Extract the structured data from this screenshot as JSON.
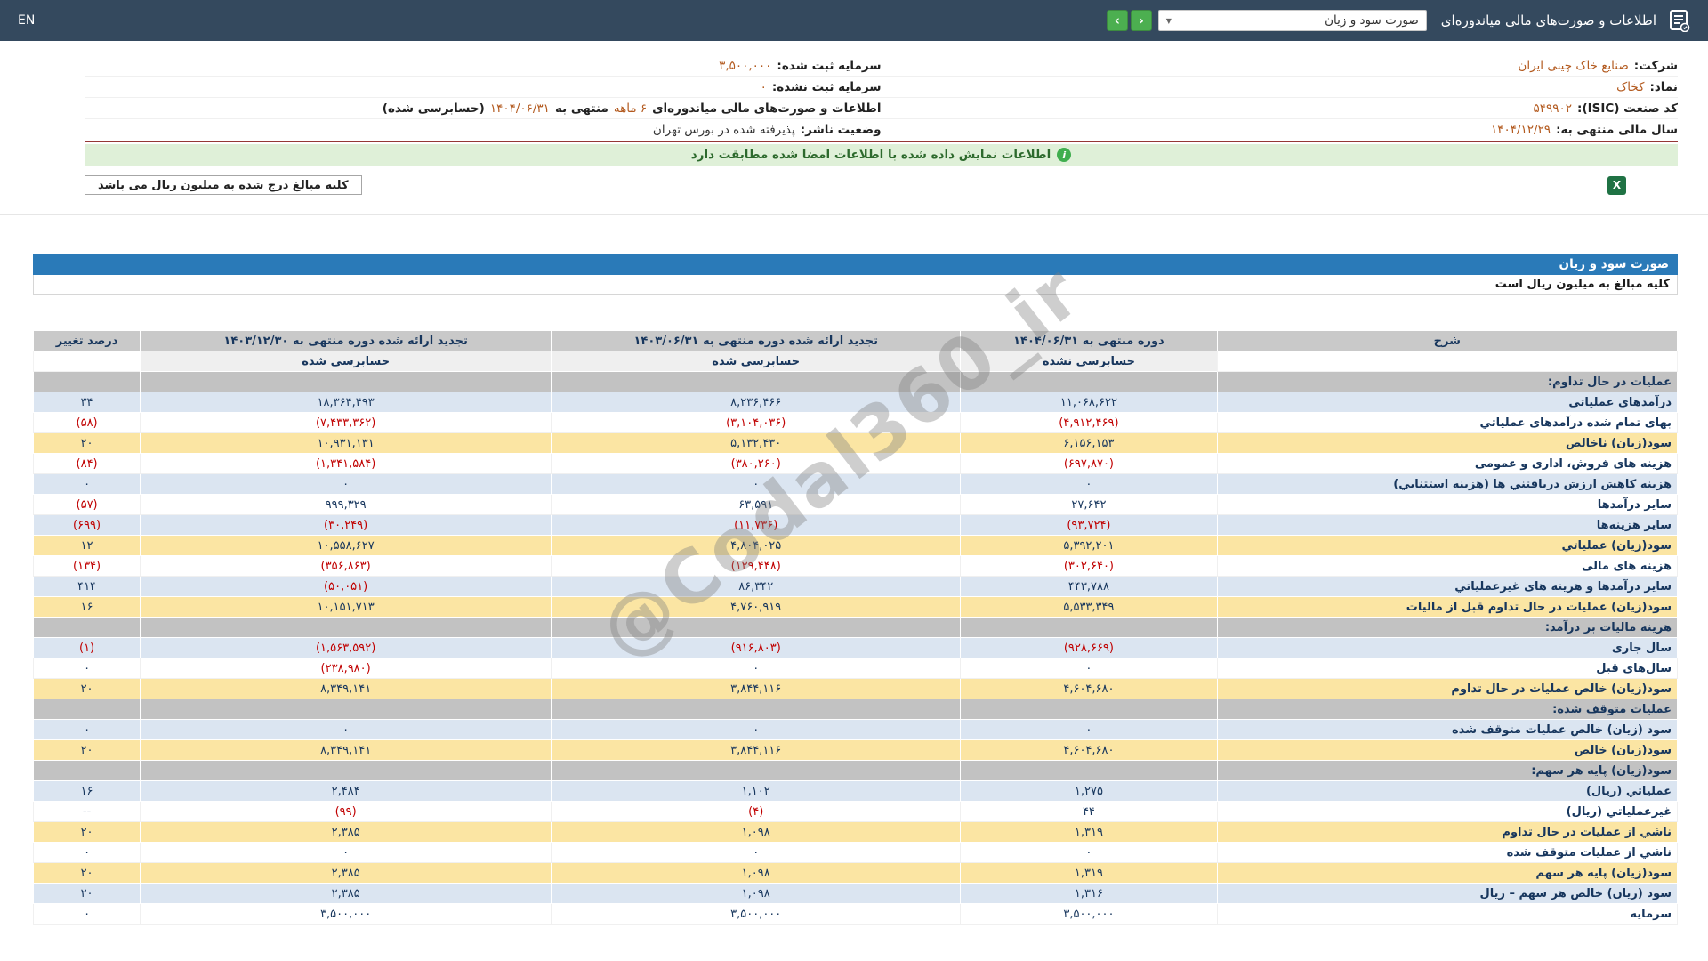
{
  "topbar": {
    "title": "اطلاعات و صورت‌های مالی میاندوره‌ای",
    "dropdown_value": "صورت سود و زیان",
    "prev_label": "‹",
    "next_label": "›",
    "en_label": "EN"
  },
  "company_info": {
    "right_column": [
      [
        {
          "t": "شرکت:",
          "s": "label"
        },
        {
          "t": "صنایع خاک چینی ایران",
          "s": "value"
        }
      ],
      [
        {
          "t": "نماد:",
          "s": "label"
        },
        {
          "t": "کخاک",
          "s": "value"
        }
      ],
      [
        {
          "t": "کد صنعت (ISIC):",
          "s": "label"
        },
        {
          "t": "۵۴۹۹۰۲",
          "s": "value"
        }
      ],
      [
        {
          "t": "سال مالی منتهی به:",
          "s": "label"
        },
        {
          "t": "۱۴۰۴/۱۲/۲۹",
          "s": "value"
        }
      ]
    ],
    "left_column": [
      [
        {
          "t": "سرمایه ثبت شده:",
          "s": "label"
        },
        {
          "t": "۳,۵۰۰,۰۰۰",
          "s": "value"
        }
      ],
      [
        {
          "t": "سرمایه ثبت نشده:",
          "s": "label"
        },
        {
          "t": "۰",
          "s": "value"
        }
      ],
      [
        {
          "t": "اطلاعات و صورت‌های مالی میاندوره‌ای",
          "s": "label"
        },
        {
          "t": "۶ ماهه",
          "s": "value"
        },
        {
          "t": "منتهی به",
          "s": "label"
        },
        {
          "t": "۱۴۰۴/۰۶/۳۱",
          "s": "value"
        },
        {
          "t": "(حسابرسی شده)",
          "s": "label"
        }
      ],
      [
        {
          "t": "وضعیت ناشر:",
          "s": "label"
        },
        {
          "t": "پذیرفته شده در بورس تهران",
          "s": "dark"
        }
      ]
    ]
  },
  "banner": {
    "text": "اطلاعات نمایش داده شده با اطلاعات امضا شده مطابقت دارد"
  },
  "unit_note": "کلیه مبالغ درج شده به میلیون ریال می باشد",
  "watermark": "@Codal360_ir",
  "statement": {
    "title_bar": "صورت سود و زیان",
    "unit_note": "کلیه مبالغ به میلیون ریال است",
    "table": {
      "desc_header": "شرح",
      "change_header": "درصد تغییر",
      "period_columns": [
        {
          "title": "دوره منتهی به ۱۴۰۴/۰۶/۳۱",
          "sub": "حسابرسی نشده"
        },
        {
          "title": "تجدید ارائه شده دوره منتهی به ۱۴۰۳/۰۶/۳۱",
          "sub": "حسابرسی شده"
        },
        {
          "title": "تجدید ارائه شده دوره منتهی به ۱۴۰۳/۱۲/۳۰",
          "sub": "حسابرسی شده"
        }
      ],
      "rows": [
        {
          "kind": "section",
          "label": "عملیات در حال تداوم:"
        },
        {
          "kind": "blue",
          "label": "درآمدهای عملیاتي",
          "values": [
            "۱۱,۰۶۸,۶۲۲",
            "۸,۲۳۶,۴۶۶",
            "۱۸,۳۶۴,۴۹۳"
          ],
          "change": "۳۴"
        },
        {
          "kind": "white",
          "label": "بهای تمام شده درآمدهای عملیاتي",
          "values": [
            "(۴,۹۱۲,۴۶۹)",
            "(۳,۱۰۴,۰۳۶)",
            "(۷,۴۳۳,۳۶۲)"
          ],
          "change": "(۵۸)"
        },
        {
          "kind": "yellow",
          "label": "سود(زیان) ناخالص",
          "values": [
            "۶,۱۵۶,۱۵۳",
            "۵,۱۳۲,۴۳۰",
            "۱۰,۹۳۱,۱۳۱"
          ],
          "change": "۲۰"
        },
        {
          "kind": "white",
          "label": "هزینه های فروش، اداری و عمومی",
          "values": [
            "(۶۹۷,۸۷۰)",
            "(۳۸۰,۲۶۰)",
            "(۱,۳۴۱,۵۸۴)"
          ],
          "change": "(۸۴)"
        },
        {
          "kind": "blue",
          "label": "هزینه کاهش ارزش دریافتني ها (هزینه استثنایي)",
          "values": [
            "۰",
            "۰",
            "۰"
          ],
          "change": "۰"
        },
        {
          "kind": "white",
          "label": "سایر درآمدها",
          "values": [
            "۲۷,۶۴۲",
            "۶۳,۵۹۱",
            "۹۹۹,۳۲۹"
          ],
          "change": "(۵۷)"
        },
        {
          "kind": "blue",
          "label": "سایر هزینه‌ها",
          "values": [
            "(۹۳,۷۲۴)",
            "(۱۱,۷۳۶)",
            "(۳۰,۲۴۹)"
          ],
          "change": "(۶۹۹)"
        },
        {
          "kind": "yellow",
          "label": "سود(زیان) عملیاتي",
          "values": [
            "۵,۳۹۲,۲۰۱",
            "۴,۸۰۴,۰۲۵",
            "۱۰,۵۵۸,۶۲۷"
          ],
          "change": "۱۲"
        },
        {
          "kind": "white",
          "label": "هزینه های مالی",
          "values": [
            "(۳۰۲,۶۴۰)",
            "(۱۲۹,۴۴۸)",
            "(۳۵۶,۸۶۳)"
          ],
          "change": "(۱۳۴)"
        },
        {
          "kind": "blue",
          "label": "سایر درآمدها و هزینه های غیرعملیاتي",
          "values": [
            "۴۴۳,۷۸۸",
            "۸۶,۳۴۲",
            "(۵۰,۰۵۱)"
          ],
          "change": "۴۱۴"
        },
        {
          "kind": "yellow",
          "label": "سود(زیان) عملیات در حال تداوم قبل از مالیات",
          "values": [
            "۵,۵۳۳,۳۴۹",
            "۴,۷۶۰,۹۱۹",
            "۱۰,۱۵۱,۷۱۳"
          ],
          "change": "۱۶"
        },
        {
          "kind": "section",
          "label": "هزینه مالیات بر درآمد:"
        },
        {
          "kind": "blue",
          "label": "سال جاری",
          "values": [
            "(۹۲۸,۶۶۹)",
            "(۹۱۶,۸۰۳)",
            "(۱,۵۶۳,۵۹۲)"
          ],
          "change": "(۱)"
        },
        {
          "kind": "white",
          "label": "سال‌های قبل",
          "values": [
            "۰",
            "۰",
            "(۲۳۸,۹۸۰)"
          ],
          "change": "۰"
        },
        {
          "kind": "yellow",
          "label": "سود(زیان) خالص عملیات در حال تداوم",
          "values": [
            "۴,۶۰۴,۶۸۰",
            "۳,۸۴۴,۱۱۶",
            "۸,۳۴۹,۱۴۱"
          ],
          "change": "۲۰"
        },
        {
          "kind": "section",
          "label": "عملیات متوقف شده:"
        },
        {
          "kind": "blue",
          "label": "سود (زیان) خالص عملیات متوقف شده",
          "values": [
            "۰",
            "۰",
            "۰"
          ],
          "change": "۰"
        },
        {
          "kind": "yellow",
          "label": "سود(زیان) خالص",
          "values": [
            "۴,۶۰۴,۶۸۰",
            "۳,۸۴۴,۱۱۶",
            "۸,۳۴۹,۱۴۱"
          ],
          "change": "۲۰"
        },
        {
          "kind": "section",
          "label": "سود(زیان) پایه هر سهم:"
        },
        {
          "kind": "blue",
          "label": "عملیاتي (ریال)",
          "values": [
            "۱,۲۷۵",
            "۱,۱۰۲",
            "۲,۴۸۴"
          ],
          "change": "۱۶"
        },
        {
          "kind": "white",
          "label": "غیرعملیاتي (ریال)",
          "values": [
            "۴۴",
            "(۴)",
            "(۹۹)"
          ],
          "change": "--"
        },
        {
          "kind": "yellow",
          "label": "ناشي از عملیات در حال تداوم",
          "values": [
            "۱,۳۱۹",
            "۱,۰۹۸",
            "۲,۳۸۵"
          ],
          "change": "۲۰"
        },
        {
          "kind": "white",
          "label": "ناشي از عملیات متوقف شده",
          "values": [
            "۰",
            "۰",
            "۰"
          ],
          "change": "۰"
        },
        {
          "kind": "yellow",
          "label": "سود(زیان) پایه هر سهم",
          "values": [
            "۱,۳۱۹",
            "۱,۰۹۸",
            "۲,۳۸۵"
          ],
          "change": "۲۰"
        },
        {
          "kind": "blue",
          "label": "سود (زیان) خالص هر سهم – ریال",
          "values": [
            "۱,۳۱۶",
            "۱,۰۹۸",
            "۲,۳۸۵"
          ],
          "change": "۲۰"
        },
        {
          "kind": "white",
          "label": "سرمایه",
          "values": [
            "۳,۵۰۰,۰۰۰",
            "۳,۵۰۰,۰۰۰",
            "۳,۵۰۰,۰۰۰"
          ],
          "change": "۰"
        }
      ]
    }
  },
  "colors": {
    "topbar": "#34495e",
    "accent_green": "#4caf50",
    "banner_bg": "#dff0d8",
    "title_bar_blue": "#2a7ab8",
    "row_blue": "#dbe5f1",
    "row_yellow": "#fbe5a3",
    "section_gray": "#c2c2c2",
    "value_orange": "#b35a1f",
    "negative_red": "#c00000",
    "navy_text": "#17365d",
    "maroon_line": "#953735"
  }
}
